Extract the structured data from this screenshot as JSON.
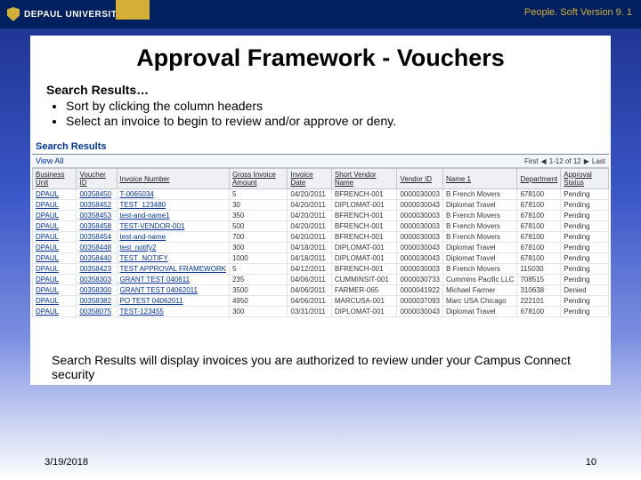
{
  "header": {
    "university": "DEPAUL UNIVERSITY",
    "version": "People. Soft Version 9. 1"
  },
  "title": "Approval Framework - Vouchers",
  "intro": {
    "lead": "Search Results…",
    "bullets": [
      "Sort by clicking the column headers",
      "Select an invoice to begin to review and/or approve or deny."
    ]
  },
  "panel": {
    "title": "Search Results",
    "view_all": "View All",
    "pager": {
      "first": "First",
      "range": "1-12 of 12",
      "last": "Last"
    },
    "columns": [
      "Business Unit",
      "Voucher ID",
      "Invoice Number",
      "Gross Invoice Amount",
      "Invoice Date",
      "Short Vendor Name",
      "Vendor ID",
      "Name 1",
      "Department",
      "Approval Status"
    ],
    "rows": [
      {
        "bu": "DPAUL",
        "vid": "00358450",
        "inv": "T-0065034",
        "amt": "5",
        "date": "04/20/2011",
        "svn": "BFRENCH-001",
        "ven": "0000030003",
        "name": "B French Movers",
        "dept": "678100",
        "stat": "Pending"
      },
      {
        "bu": "DPAUL",
        "vid": "00358452",
        "inv": "TEST_123480",
        "amt": "30",
        "date": "04/20/2011",
        "svn": "DIPLOMAT-001",
        "ven": "0000030043",
        "name": "Diplomat Travel",
        "dept": "678100",
        "stat": "Pending"
      },
      {
        "bu": "DPAUL",
        "vid": "00358453",
        "inv": "test-and-name1",
        "amt": "350",
        "date": "04/20/2011",
        "svn": "BFRENCH-001",
        "ven": "0000030003",
        "name": "B French Movers",
        "dept": "678100",
        "stat": "Pending"
      },
      {
        "bu": "DPAUL",
        "vid": "00358458",
        "inv": "TEST-VENDOR-001",
        "amt": "500",
        "date": "04/20/2011",
        "svn": "BFRENCH-001",
        "ven": "0000030003",
        "name": "B French Movers",
        "dept": "678100",
        "stat": "Pending"
      },
      {
        "bu": "DPAUL",
        "vid": "00358454",
        "inv": "test-and-name",
        "amt": "700",
        "date": "04/20/2011",
        "svn": "BFRENCH-001",
        "ven": "0000030003",
        "name": "B French Movers",
        "dept": "678100",
        "stat": "Pending"
      },
      {
        "bu": "DPAUL",
        "vid": "00358448",
        "inv": "test_notify2",
        "amt": "300",
        "date": "04/18/2011",
        "svn": "DIPLOMAT-001",
        "ven": "0000030043",
        "name": "Diplomat Travel",
        "dept": "678100",
        "stat": "Pending"
      },
      {
        "bu": "DPAUL",
        "vid": "00358440",
        "inv": "TEST_NOTIFY",
        "amt": "1000",
        "date": "04/18/2011",
        "svn": "DIPLOMAT-001",
        "ven": "0000030043",
        "name": "Diplomat Travel",
        "dept": "678100",
        "stat": "Pending"
      },
      {
        "bu": "DPAUL",
        "vid": "00358423",
        "inv": "TEST APPROVAL FRAMEWORK",
        "amt": "5",
        "date": "04/12/2011",
        "svn": "BFRENCH-001",
        "ven": "0000030003",
        "name": "B French Movers",
        "dept": "115030",
        "stat": "Pending"
      },
      {
        "bu": "DPAUL",
        "vid": "00358303",
        "inv": "GRANT TEST 040611",
        "amt": "235",
        "date": "04/06/2011",
        "svn": "CUMMINSIT-001",
        "ven": "0000030733",
        "name": "Cummins Pacific LLC",
        "dept": "708515",
        "stat": "Pending"
      },
      {
        "bu": "DPAUL",
        "vid": "00358300",
        "inv": "GRANT TEST 04062011",
        "amt": "3500",
        "date": "04/06/2011",
        "svn": "FARMER-065",
        "ven": "0000041922",
        "name": "Michael Farmer",
        "dept": "310638",
        "stat": "Denied"
      },
      {
        "bu": "DPAUL",
        "vid": "00358382",
        "inv": "PO TEST 04062011",
        "amt": "4950",
        "date": "04/06/2011",
        "svn": "MARCUSA-001",
        "ven": "0000037093",
        "name": "Marc USA Chicago",
        "dept": "222101",
        "stat": "Pending"
      },
      {
        "bu": "DPAUL",
        "vid": "00358075",
        "inv": "TEST-123455",
        "amt": "300",
        "date": "03/31/2011",
        "svn": "DIPLOMAT-001",
        "ven": "0000030043",
        "name": "Diplomat Travel",
        "dept": "678100",
        "stat": "Pending"
      }
    ]
  },
  "caption": "Search Results will display invoices you are authorized to review under your Campus Connect security",
  "footer": {
    "date": "3/19/2018",
    "page": "10"
  }
}
